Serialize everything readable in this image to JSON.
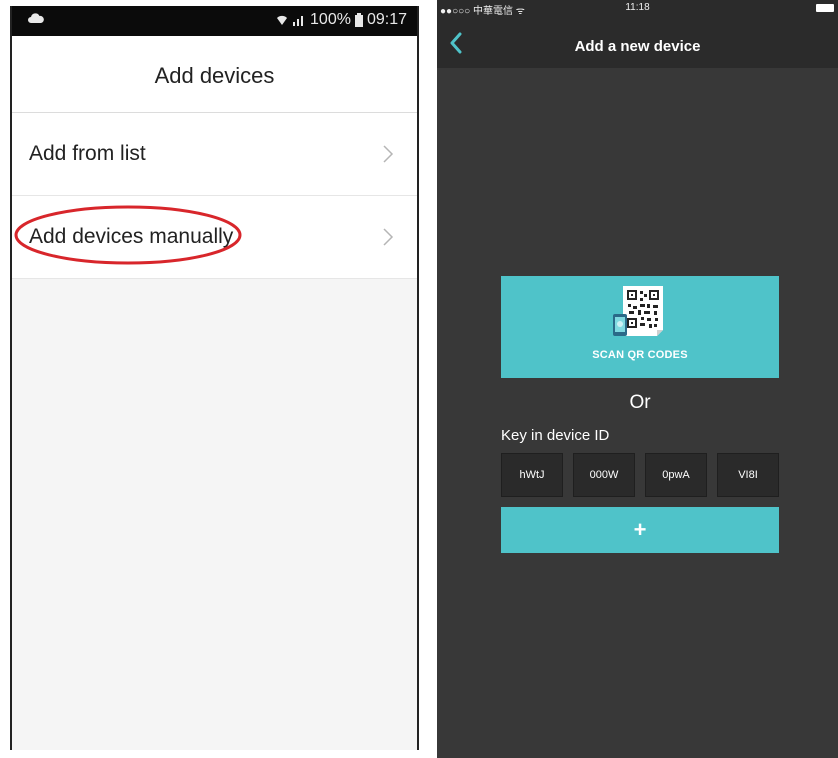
{
  "left_screen": {
    "status_bar": {
      "battery": "100%",
      "time": "09:17",
      "icons": [
        "cloud-icon",
        "wifi-icon",
        "signal-icon",
        "battery-icon"
      ]
    },
    "header": {
      "title": "Add devices"
    },
    "list": [
      {
        "label": "Add from list"
      },
      {
        "label": "Add devices manually"
      }
    ],
    "highlight_color": "#d8262b"
  },
  "right_screen": {
    "status_bar": {
      "carrier": "●●○○○ 中華電信 ᯤ",
      "time": "11:18"
    },
    "nav": {
      "title": "Add a new device",
      "back_icon": "chevron-left-icon"
    },
    "scan": {
      "label": "SCAN QR CODES",
      "icon": "qr-code-icon"
    },
    "or_text": "Or",
    "device_id": {
      "label": "Key in device ID",
      "segments": [
        "hWtJ",
        "000W",
        "0pwA",
        "VI8I"
      ]
    },
    "add_button": {
      "label": "+"
    },
    "accent_color": "#4fc3c9",
    "background_color": "#383838"
  }
}
